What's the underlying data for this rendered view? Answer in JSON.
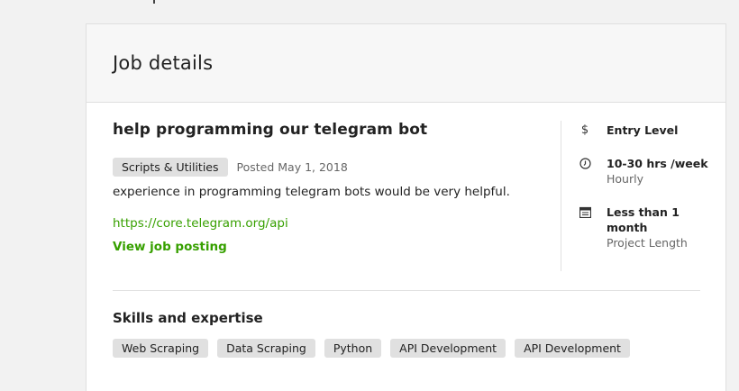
{
  "card": {
    "title": "Job details"
  },
  "job": {
    "title": "help programming our telegram bot",
    "category": "Scripts & Utilities",
    "posted": "Posted May 1, 2018",
    "description": "experience in programming telegram bots would be very helpful.",
    "link": "https://core.telegram.org/api",
    "view_posting": "View job posting"
  },
  "sidebar": {
    "items": [
      {
        "icon": "dollar-icon",
        "strong": "Entry Level",
        "sub": ""
      },
      {
        "icon": "info-clock-icon",
        "strong": "10-30 hrs /week",
        "sub": "Hourly"
      },
      {
        "icon": "calendar-icon",
        "strong": "Less than 1 month",
        "sub": "Project Length"
      }
    ]
  },
  "skills": {
    "title": "Skills and expertise",
    "items": [
      "Web Scraping",
      "Data Scraping",
      "Python",
      "API Development",
      "API Development"
    ]
  },
  "colors": {
    "link_green": "#37a000",
    "tag_bg": "#e0e0e0",
    "header_bg": "#f7f7f7"
  }
}
